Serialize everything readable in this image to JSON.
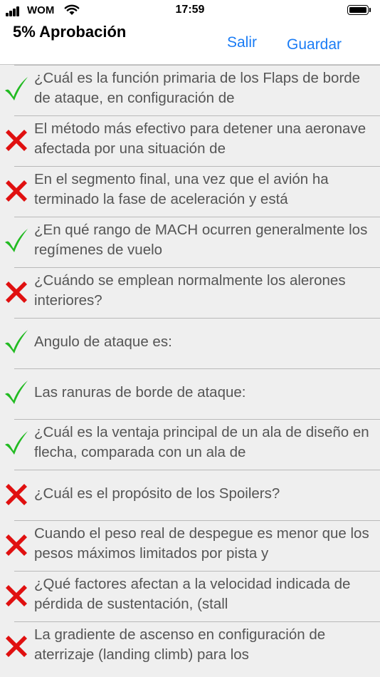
{
  "status_bar": {
    "carrier": "WOM",
    "time": "17:59"
  },
  "nav": {
    "title": "5% Aprobación",
    "exit_label": "Salir",
    "save_label": "Guardar"
  },
  "colors": {
    "accent": "#1a7cf5",
    "correct": "#22bb22",
    "wrong": "#e01010",
    "row_background": "#efefef"
  },
  "questions": [
    {
      "status": "correct",
      "text": "¿Cuál es la función primaria de los Flaps de borde de ataque, en configuración de"
    },
    {
      "status": "wrong",
      "text": "El método más efectivo para detener una aeronave afectada por una situación de"
    },
    {
      "status": "wrong",
      "text": "En el segmento final, una vez que el avión ha terminado la fase de aceleración y está"
    },
    {
      "status": "correct",
      "text": "¿En qué rango de MACH ocurren generalmente los regímenes de vuelo"
    },
    {
      "status": "wrong",
      "text": "¿Cuándo se emplean normalmente los alerones interiores?"
    },
    {
      "status": "correct",
      "text": "Angulo de ataque es:"
    },
    {
      "status": "correct",
      "text": "Las ranuras de borde de ataque:"
    },
    {
      "status": "correct",
      "text": "¿Cuál es la ventaja principal de un ala de diseño en flecha, comparada con un ala de"
    },
    {
      "status": "wrong",
      "text": "¿Cuál es el propósito de los Spoilers?"
    },
    {
      "status": "wrong",
      "text": "Cuando el peso real de despegue es menor que los pesos máximos limitados por pista y"
    },
    {
      "status": "wrong",
      "text": "¿Qué factores afectan a la velocidad indicada de pérdida de sustentación, (stall"
    },
    {
      "status": "wrong",
      "text": "La gradiente de ascenso en configuración de aterrizaje (landing climb) para los"
    }
  ]
}
